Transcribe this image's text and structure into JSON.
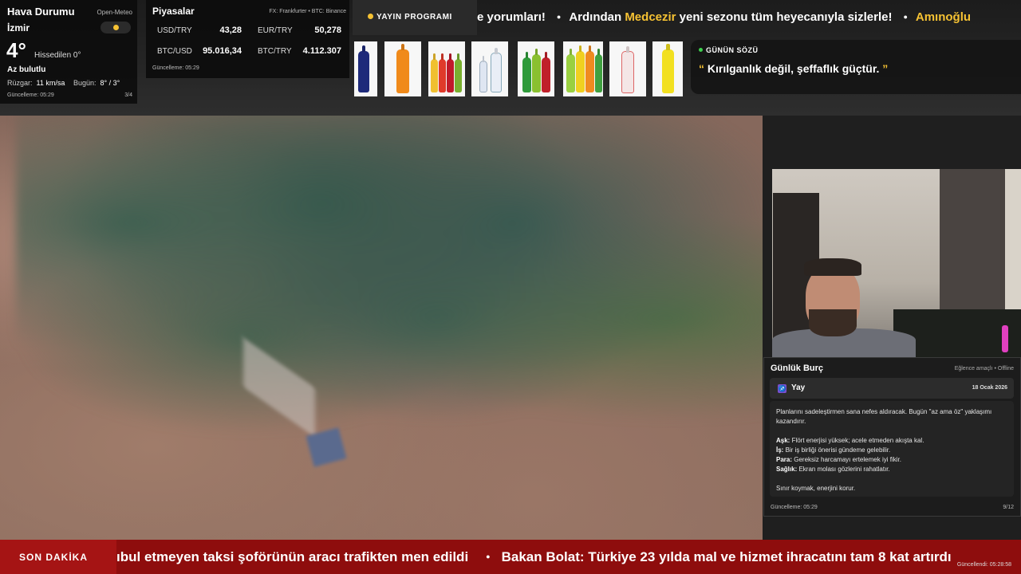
{
  "weather": {
    "title": "Hava Durumu",
    "provider": "Open-Meteo",
    "city": "İzmir",
    "temp": "4°",
    "feels_like": "Hissedilen 0°",
    "condition": "Az bulutlu",
    "wind_label": "Rüzgar:",
    "wind_value": "11 km/sa",
    "today_label": "Bugün:",
    "today_value": "8° / 3°",
    "updated": "Güncelleme: 05:29",
    "page": "3/4"
  },
  "markets": {
    "title": "Piyasalar",
    "source": "FX: Frankfurter • BTC: Binance",
    "rows": [
      {
        "label": "USD/TRY",
        "value": "43,28"
      },
      {
        "label": "EUR/TRY",
        "value": "50,278"
      },
      {
        "label": "BTC/USD",
        "value": "95.016,34"
      },
      {
        "label": "BTC/TRY",
        "value": "4.112.307"
      }
    ],
    "updated": "Güncelleme: 05:29"
  },
  "program": {
    "label": "YAYIN PROGRAMI"
  },
  "top_ticker": {
    "item1": "e yorumları!",
    "item2_pre": "Ardından ",
    "item2_highlight": "Medcezir",
    "item2_post": " yeni sezonu tüm heyecanıyla sizlerle!",
    "item3": "Amınoğlu"
  },
  "quote": {
    "label": "GÜNÜN SÖZÜ",
    "text": "Kırılganlık değil, şeffaflık güçtür."
  },
  "horoscope": {
    "title": "Günlük Burç",
    "meta": "Eğlence amaçlı • Offline",
    "sign": "Yay",
    "date": "18 Ocak 2026",
    "intro": "Planlarını sadeleştirmen sana nefes aldıracak. Bugün \"az ama öz\" yaklaşımı kazandırır.",
    "love_label": "Aşk:",
    "love": " Flört enerjisi yüksek; acele etmeden akışta kal.",
    "work_label": "İş:",
    "work": " Bir iş birliği önerisi gündeme gelebilir.",
    "money_label": "Para:",
    "money": " Gereksiz harcamayı ertelemek iyi fikir.",
    "health_label": "Sağlık:",
    "health": " Ekran molası gözlerini rahatlatır.",
    "closing": "Sınır koymak, enerjini korur.",
    "updated": "Güncelleme: 05:29",
    "page": "9/12"
  },
  "breaking": {
    "badge": "SON DAKİKA",
    "item1": "ıbul etmeyen taksi şoförünün aracı trafikten men edildi",
    "item2": "Bakan Bolat: Türkiye 23 yılda mal ve hizmet ihracatını tam 8 kat artırdı",
    "updated": "Güncellendi: 05:28:58"
  }
}
